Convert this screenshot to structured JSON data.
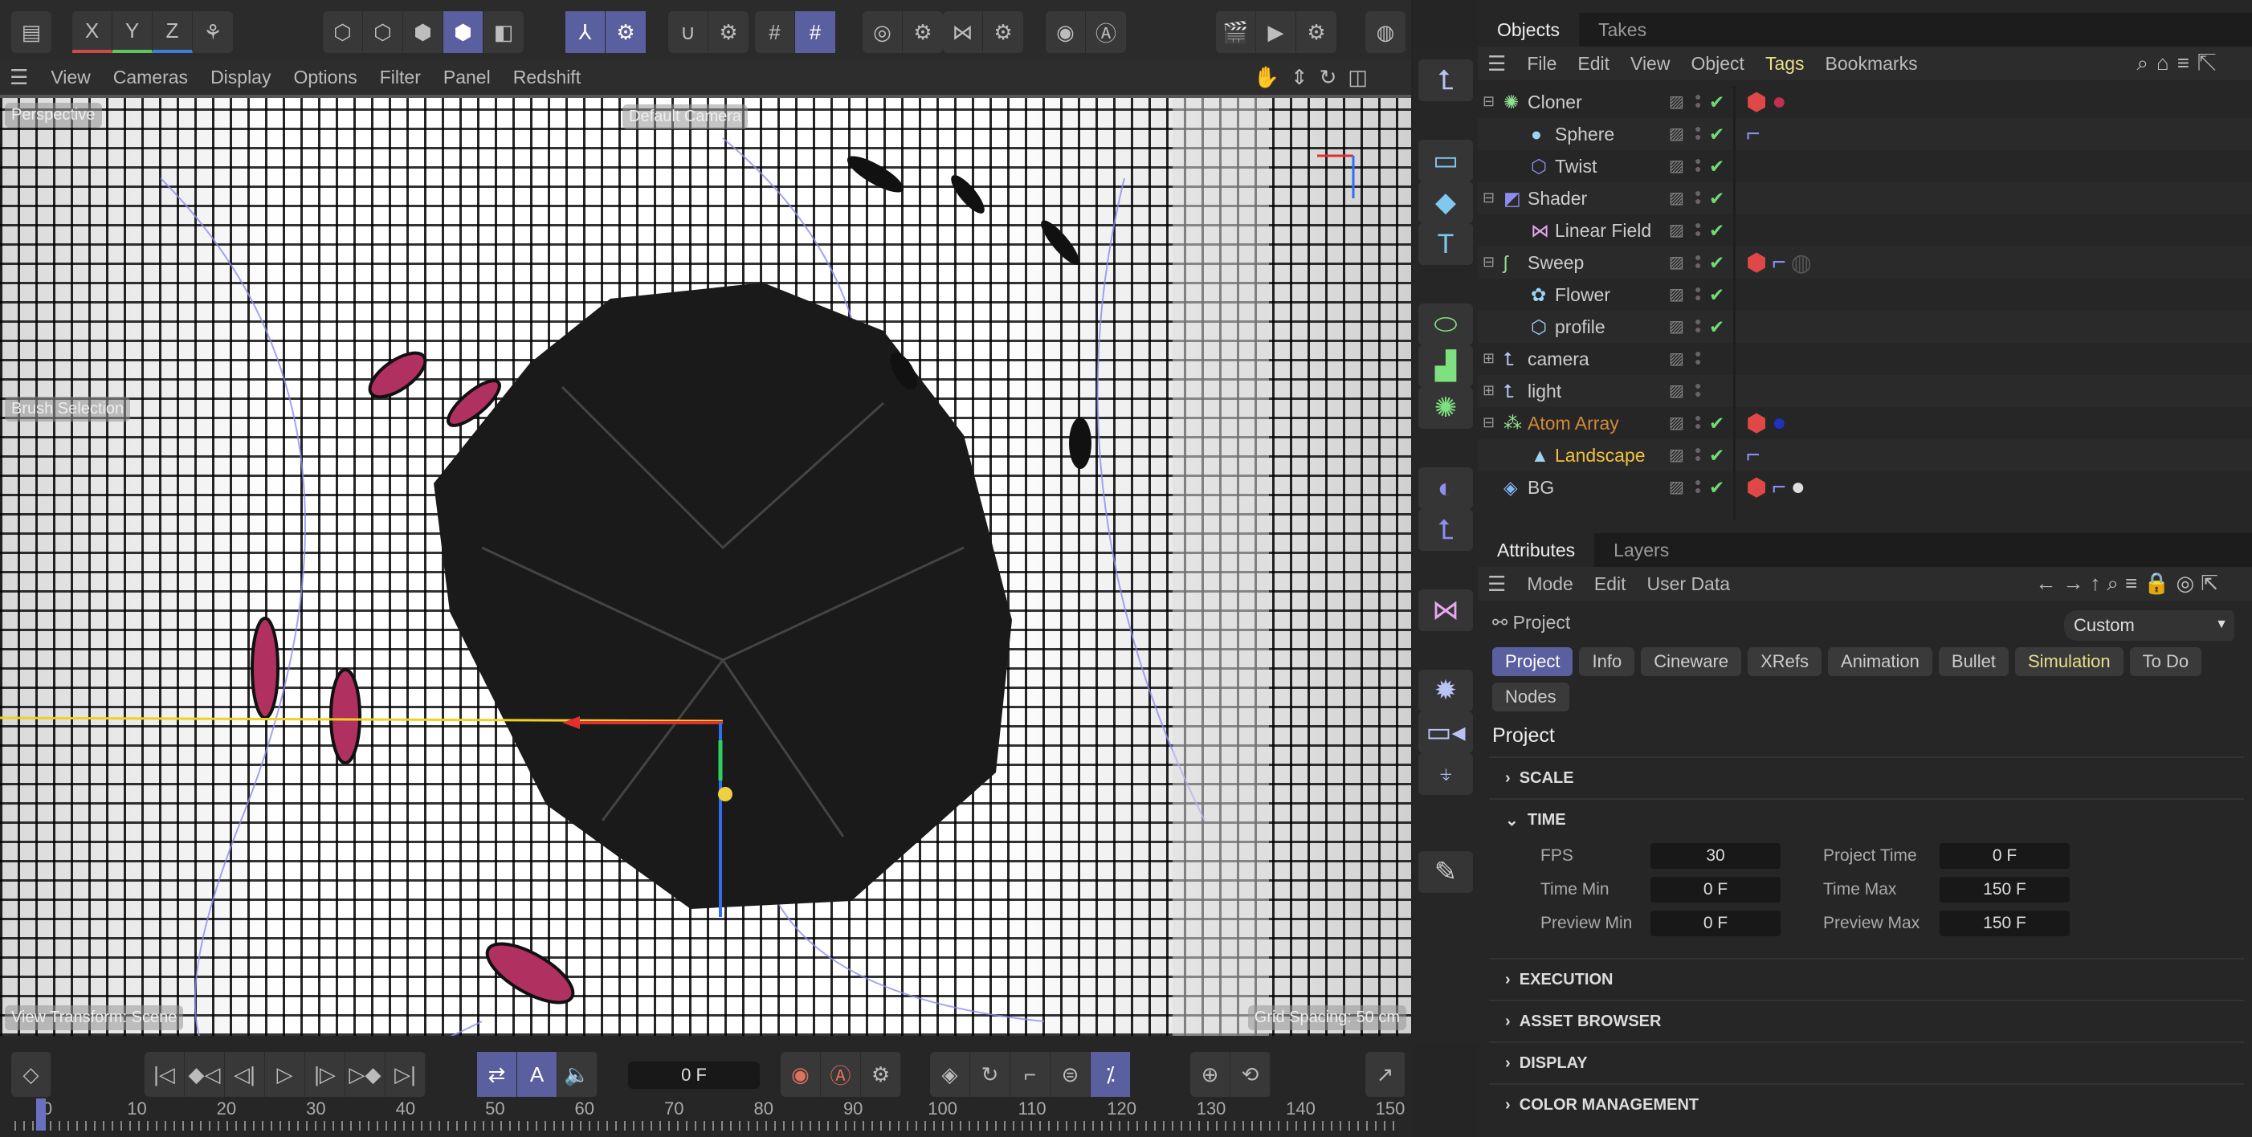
{
  "toolbar": {
    "groups": [
      [
        "layout-icon"
      ],
      [
        "x-axis-icon",
        "y-axis-icon",
        "z-axis-icon",
        "world-coords-icon"
      ],
      [
        "points-mode-icon",
        "edges-mode-icon",
        "polygons-mode-icon",
        "model-mode-icon",
        "texture-mode-icon"
      ],
      [
        "axis-mode-icon",
        "gear-icon"
      ],
      [
        "magnet-icon",
        "gear-icon"
      ],
      [
        "snap-grid-icon",
        "snap-lock-icon"
      ],
      [
        "target-icon",
        "gear-icon"
      ],
      [
        "symmetry-icon",
        "gear-icon"
      ],
      [
        "view-eye-icon",
        "auto-icon"
      ],
      [
        "render-region-icon",
        "render-view-icon",
        "render-settings-icon"
      ],
      [
        "redshift-icon"
      ]
    ],
    "axis_labels": [
      "X",
      "Y",
      "Z"
    ]
  },
  "viewport": {
    "menu": [
      "View",
      "Cameras",
      "Display",
      "Options",
      "Filter",
      "Panel",
      "Redshift"
    ],
    "overlays": {
      "view_name": "Perspective",
      "camera": "Default Camera",
      "tool": "Brush Selection",
      "transform": "View Transform: Scene",
      "grid": "Grid Spacing: 50 cm"
    }
  },
  "tool_column": [
    "null-object-icon",
    "rectangle-spline-icon",
    "cube-icon",
    "text-icon",
    "cloner-icon",
    "voronoi-icon",
    "atom-array-icon",
    "deformer-icon",
    "null-xform-icon",
    "field-icon",
    "environment-icon",
    "camera-icon",
    "light-icon",
    "edit-icon"
  ],
  "objects": {
    "tabs": [
      "Objects",
      "Takes"
    ],
    "menu": [
      "File",
      "Edit",
      "View",
      "Object",
      "Tags",
      "Bookmarks"
    ],
    "rows": [
      {
        "name": "Cloner",
        "depth": 0,
        "expand": "-",
        "icon": "✺",
        "icolor": "#8fe08f",
        "check": true,
        "tags": [
          "material",
          "sphere-red"
        ]
      },
      {
        "name": "Sphere",
        "depth": 1,
        "icon": "●",
        "icolor": "#9fd3f5",
        "check": true,
        "tags": [
          "display"
        ]
      },
      {
        "name": "Twist",
        "depth": 1,
        "icon": "⬡",
        "icolor": "#8d8ff0",
        "check": true,
        "tags": []
      },
      {
        "name": "Shader",
        "depth": 0,
        "expand": "-",
        "icon": "◩",
        "icolor": "#8d8ff0",
        "check": true,
        "tags": []
      },
      {
        "name": "Linear Field",
        "depth": 1,
        "icon": "⋈",
        "icolor": "#e8a6f0",
        "check": true,
        "tags": []
      },
      {
        "name": "Sweep",
        "depth": 0,
        "expand": "-",
        "icon": "ʃ",
        "icolor": "#8fe08f",
        "check": true,
        "tags": [
          "material",
          "display",
          "texture-dark"
        ]
      },
      {
        "name": "Flower",
        "depth": 1,
        "icon": "✿",
        "icolor": "#9fd3f5",
        "check": true,
        "tags": []
      },
      {
        "name": "profile",
        "depth": 1,
        "icon": "⬡",
        "icolor": "#9fd3f5",
        "check": true,
        "tags": []
      },
      {
        "name": "camera",
        "depth": 0,
        "expand": "+",
        "icon": "⮤",
        "icolor": "#b9c4f5",
        "check": false,
        "tags": []
      },
      {
        "name": "light",
        "depth": 0,
        "expand": "+",
        "icon": "⮤",
        "icolor": "#b9c4f5",
        "check": false,
        "tags": []
      },
      {
        "name": "Atom Array",
        "depth": 0,
        "expand": "-",
        "icon": "⁂",
        "icolor": "#8fe08f",
        "color": "#d08a3a",
        "check": true,
        "tags": [
          "material",
          "sphere-blue"
        ]
      },
      {
        "name": "Landscape",
        "depth": 1,
        "icon": "▲",
        "icolor": "#9fd3f5",
        "color": "#f0c040",
        "check": true,
        "tags": [
          "display"
        ]
      },
      {
        "name": "BG",
        "depth": 0,
        "icon": "◈",
        "icolor": "#7fb8f0",
        "check": true,
        "tags": [
          "material",
          "display",
          "sphere-white"
        ]
      }
    ]
  },
  "attributes": {
    "tabs": [
      "Attributes",
      "Layers"
    ],
    "menu": [
      "Mode",
      "Edit",
      "User Data"
    ],
    "object_label": "Project",
    "preset": "Custom",
    "pills": [
      "Project",
      "Info",
      "Cineware",
      "XRefs",
      "Animation",
      "Bullet",
      "Simulation",
      "To Do",
      "Nodes"
    ],
    "heading": "Project",
    "sections": {
      "scale": "SCALE",
      "time": "TIME",
      "execution": "EXECUTION",
      "asset": "ASSET BROWSER",
      "display": "DISPLAY",
      "color": "COLOR MANAGEMENT"
    },
    "time": {
      "fps_label": "FPS",
      "fps": "30",
      "ptime_label": "Project Time",
      "ptime": "0 F",
      "tmin_label": "Time Min",
      "tmin": "0 F",
      "tmax_label": "Time Max",
      "tmax": "150 F",
      "pmin_label": "Preview Min",
      "pmin": "0 F",
      "pmax_label": "Preview Max",
      "pmax": "150 F"
    }
  },
  "timeline": {
    "current_frame": "0 F",
    "ruler": [
      "0",
      "10",
      "20",
      "30",
      "40",
      "50",
      "60",
      "70",
      "80",
      "90",
      "100",
      "110",
      "120",
      "130",
      "140",
      "150"
    ],
    "frame_value": 0,
    "max_frame": 150
  },
  "colors": {
    "accent": "#5a5fa0",
    "check": "#6fdc6f",
    "tags_active": "#e6e08a"
  }
}
